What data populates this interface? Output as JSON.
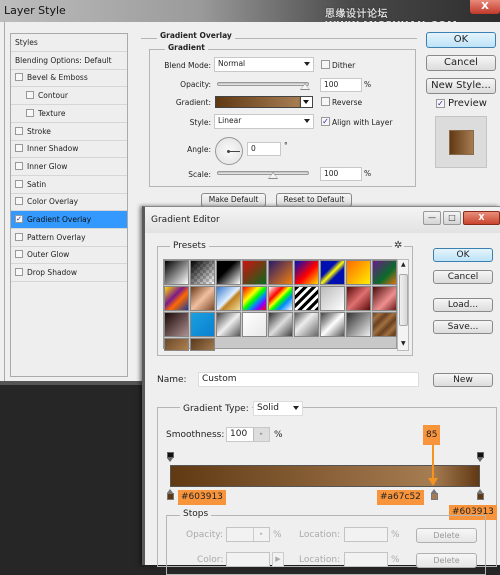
{
  "layer_style": {
    "title": "Layer Style",
    "watermark": "思缘设计论坛 WWW.MISSYUAN.COM",
    "close_glyph": "X",
    "styles_list": [
      {
        "label": "Styles",
        "type": "header"
      },
      {
        "label": "Blending Options: Default",
        "type": "header"
      },
      {
        "label": "Bevel & Emboss",
        "checked": false
      },
      {
        "label": "Contour",
        "checked": false,
        "indent": true
      },
      {
        "label": "Texture",
        "checked": false,
        "indent": true
      },
      {
        "label": "Stroke",
        "checked": false
      },
      {
        "label": "Inner Shadow",
        "checked": false
      },
      {
        "label": "Inner Glow",
        "checked": false
      },
      {
        "label": "Satin",
        "checked": false
      },
      {
        "label": "Color Overlay",
        "checked": false
      },
      {
        "label": "Gradient Overlay",
        "checked": true,
        "selected": true
      },
      {
        "label": "Pattern Overlay",
        "checked": false
      },
      {
        "label": "Outer Glow",
        "checked": false
      },
      {
        "label": "Drop Shadow",
        "checked": false
      }
    ],
    "gradient_overlay": {
      "section_title": "Gradient Overlay",
      "group_title": "Gradient",
      "blend_mode_label": "Blend Mode:",
      "blend_mode_value": "Normal",
      "dither_label": "Dither",
      "dither_checked": false,
      "opacity_label": "Opacity:",
      "opacity_value": "100",
      "opacity_unit": "%",
      "gradient_label": "Gradient:",
      "reverse_label": "Reverse",
      "reverse_checked": false,
      "style_label": "Style:",
      "style_value": "Linear",
      "align_label": "Align with Layer",
      "align_checked": true,
      "angle_label": "Angle:",
      "angle_value": "0",
      "angle_unit": "°",
      "scale_label": "Scale:",
      "scale_value": "100",
      "scale_unit": "%",
      "make_default": "Make Default",
      "reset_default": "Reset to Default"
    },
    "buttons": {
      "ok": "OK",
      "cancel": "Cancel",
      "new_style": "New Style...",
      "preview_label": "Preview",
      "preview_checked": true
    }
  },
  "gradient_editor": {
    "title": "Gradient Editor",
    "window_controls": {
      "minimize": "—",
      "maximize": "□",
      "close": "X"
    },
    "presets_label": "Presets",
    "presets_menu_glyph": "✲",
    "buttons": {
      "ok": "OK",
      "cancel": "Cancel",
      "load": "Load...",
      "save": "Save...",
      "new": "New"
    },
    "name_label": "Name:",
    "name_value": "Custom",
    "gradient_type_label": "Gradient Type:",
    "gradient_type_value": "Solid",
    "smoothness_label": "Smoothness:",
    "smoothness_value": "100",
    "smoothness_unit": "%",
    "presets": [
      "linear-gradient(135deg,#000 0%,#fff 100%)",
      "linear-gradient(135deg,#000 0%,rgba(0,0,0,0) 100%)",
      "linear-gradient(135deg,#000 0%,#000 40%,#fff 100%)",
      "linear-gradient(135deg,#d01010 0%,#0a6a1a 100%)",
      "linear-gradient(135deg,#2a1a6a 0%,#f08010 100%)",
      "linear-gradient(135deg,#0010c0 0%,#ff0000 55%,#ffdd00 100%)",
      "linear-gradient(135deg,#0010b0 0%,#0010b0 35%,#ffff00 50%,#0010b0 65%,#0010b0 100%)",
      "linear-gradient(135deg,#ff6a00 0%,#ffee00 100%)",
      "linear-gradient(135deg,#6a1a8a 0%,#0a6a2a 60%,#e07010 100%)",
      "linear-gradient(135deg,#ffd800 0%,#7a1a8a 40%,#ff6a00 60%,#1a3a9a 100%)",
      "linear-gradient(135deg,#6a3a1a 0%,#f0c0a0 50%,#7a4a2a 100%)",
      "linear-gradient(135deg,#3a7ad0 0%,#e0f0ff 50%,#c08020 60%,#f0e0a0 100%)",
      "linear-gradient(135deg,#ff0000 0%,#ff8800 20%,#ffff00 35%,#00ff00 50%,#0088ff 65%,#8800ff 80%,#ff0000 100%)",
      "linear-gradient(135deg,#fff 0%,#ff0000 30%,#ffff00 45%,#00ff00 55%,#0088ff 70%,#fff 100%)",
      "repeating-linear-gradient(135deg,#000 0px,#000 3px,#fff 3px,#fff 6px)",
      "linear-gradient(135deg,#bbb 0%,#fff 100%)",
      "linear-gradient(135deg,#5a0a0a 0%,#e07070 50%,#5a0a0a 100%)",
      "linear-gradient(135deg,#4a0a0a 0%,#f09090 60%,#6a1a1a 100%)",
      "linear-gradient(135deg,#1a0808 0%,#b09090 100%)",
      "linear-gradient(135deg,#1aa0e0 0%,#0a80d0 100%)",
      "linear-gradient(135deg,#444 0%,#eee 50%,#555 100%)",
      "linear-gradient(135deg,#fff 0%,#e8e8e8 100%)",
      "linear-gradient(135deg,#333 0%,#ddd 50%,#444 100%)",
      "linear-gradient(135deg,#555 0%,#eee 40%,#666 100%)",
      "linear-gradient(135deg,#444 0%,#aaa 30%,#fff 50%,#555 100%)",
      "linear-gradient(135deg,#333 0%,#eee 100%)",
      "repeating-linear-gradient(135deg,#6a4020 0px,#a07040 5px,#6a4020 10px)",
      "linear-gradient(135deg,#6a4a2a 0%,#b08050 100%)",
      "linear-gradient(135deg,#5a3a1a 0%,#a07a50 100%)"
    ],
    "gradient": {
      "stops": [
        {
          "color": "#603913",
          "location": 0
        },
        {
          "color": "#a67c52",
          "location": 85
        },
        {
          "color": "#603913",
          "location": 100
        }
      ],
      "opacity_stops": [
        {
          "opacity": 100,
          "location": 0
        },
        {
          "opacity": 100,
          "location": 100
        }
      ]
    },
    "annotations": {
      "location_callout": "85",
      "left_color": "#603913",
      "mid_color": "#a67c52",
      "right_color": "#603913"
    },
    "stops_group": {
      "title": "Stops",
      "opacity_label": "Opacity:",
      "opacity_unit": "%",
      "location_label": "Location:",
      "location_unit": "%",
      "delete_label": "Delete",
      "color_label": "Color:"
    }
  },
  "colors": {
    "selection_blue": "#3399ff",
    "callout_orange": "#f7943c",
    "stop_dark": "#603913",
    "stop_light": "#a67c52"
  }
}
